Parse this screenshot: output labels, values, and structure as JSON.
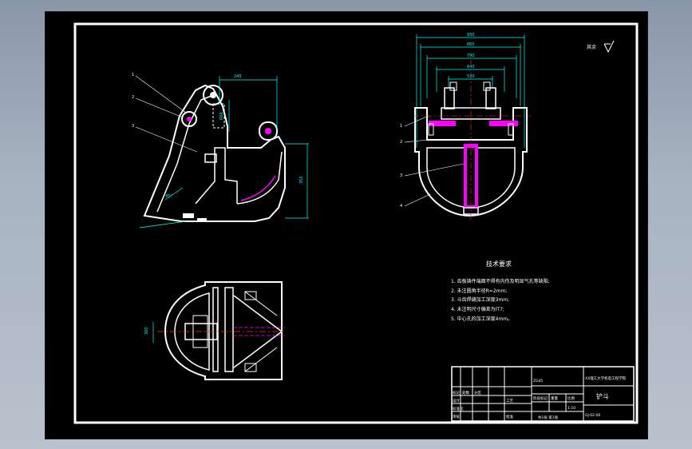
{
  "drawing": {
    "tech_req_title": "技术要求",
    "tech_req": [
      "1. 齿板铸件端面不得有内伤及明显气孔等缺陷;",
      "2. 未注圆角半径R=2mm;",
      "3. 斗齿焊缝加工深度3mm;",
      "4. 未注明尺寸偏差为IT7;",
      "5. 中心孔的加工深度4mm。"
    ],
    "roughness_note": "其余",
    "title_block": {
      "part_name": "铲斗",
      "company": "XX理工大学机电工程学院",
      "drawing_no": "GJ-02-00",
      "material": "ZG45",
      "scale": "1:10",
      "sheet_text": "共1张 第1张",
      "mass_label": "重量",
      "scale_label": "比例",
      "stage_label": "阶段标记",
      "designer_label": "设计",
      "checker_label": "审核",
      "approver_label": "批准",
      "craft_label": "工艺",
      "std_label": "标准化",
      "mark_label": "标记",
      "count_label": "处数",
      "zone_label": "分区"
    }
  },
  "colors": {
    "frame": "#ffffff",
    "line": "#ffffff",
    "dim": "#00ffff",
    "highlight": "#ff00ff",
    "center": "#ff3030"
  }
}
